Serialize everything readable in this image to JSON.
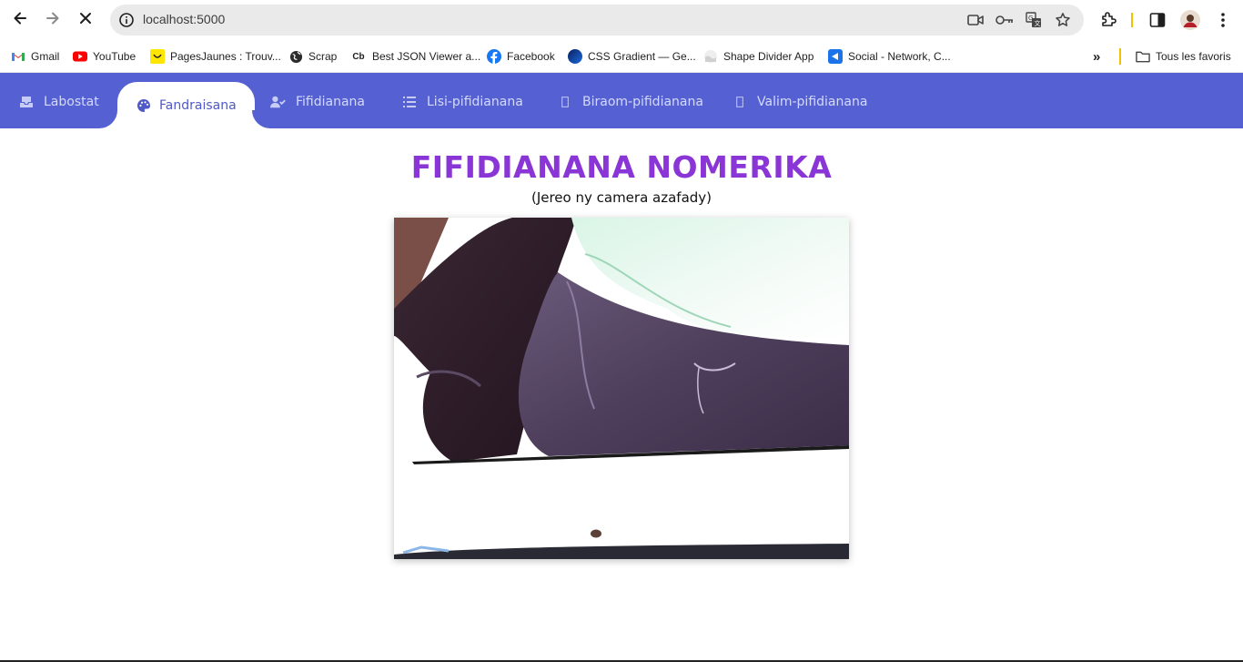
{
  "browser": {
    "url": "localhost:5000",
    "bookmarks": [
      {
        "label": "Gmail",
        "icon": "gmail-icon"
      },
      {
        "label": "YouTube",
        "icon": "youtube-icon"
      },
      {
        "label": "PagesJaunes : Trouv...",
        "icon": "pagesjaunes-icon"
      },
      {
        "label": "Scrap",
        "icon": "globe-icon"
      },
      {
        "label": "Best JSON Viewer a...",
        "icon": "codebeautify-icon",
        "badge": "Cb"
      },
      {
        "label": "Facebook",
        "icon": "facebook-icon"
      },
      {
        "label": "CSS Gradient — Ge...",
        "icon": "css-gradient-icon"
      },
      {
        "label": "Shape Divider App",
        "icon": "shape-divider-icon"
      },
      {
        "label": "Social - Network, C...",
        "icon": "social-network-icon"
      }
    ],
    "more_bookmarks": "»",
    "all_bookmarks": "Tous les favoris"
  },
  "nav": {
    "tabs": [
      {
        "label": "Labostat",
        "icon": "inbox-tray-icon",
        "active": false
      },
      {
        "label": "Fandraisana",
        "icon": "palette-icon",
        "active": true
      },
      {
        "label": "Fifidianana",
        "icon": "user-check-icon",
        "active": false
      },
      {
        "label": "Lisi-pifidianana",
        "icon": "list-icon",
        "active": false
      },
      {
        "label": "Biraom-pifidianana",
        "icon": "missing-glyph-icon",
        "active": false
      },
      {
        "label": "Valim-pifidianana",
        "icon": "missing-glyph-icon",
        "active": false
      }
    ]
  },
  "main": {
    "title": "FIFIDIANANA NOMERIKA",
    "subtitle": "(Jereo ny camera azafady)"
  },
  "colors": {
    "nav_bg": "#5561d2",
    "title": "#8a35d6",
    "active_tab_text": "#5159c9"
  }
}
